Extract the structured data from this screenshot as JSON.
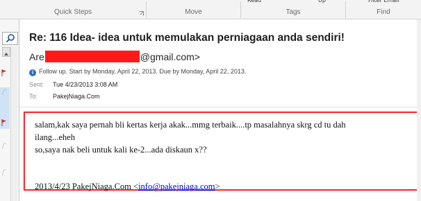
{
  "ribbon": {
    "top_labels": [
      "Read",
      "Up",
      "Filter Email"
    ],
    "groups": [
      "Quick Steps",
      "Move",
      "Tags",
      "Find"
    ]
  },
  "left": {
    "search_icon": "search-icon"
  },
  "message": {
    "subject": "Re: 116 Idea- idea untuk memulakan perniagaan anda sendiri!",
    "from_prefix": "Are",
    "from_suffix": "@gmail.com>",
    "followup": "Follow up.  Start by Monday, April 22, 2013.  Due by Monday, April 22, 2013.",
    "sent_label": "Sent:",
    "sent_value": "Tue 4/23/2013 3:08 AM",
    "to_label": "To:",
    "to_value": "PakejNiaga.Com"
  },
  "body": {
    "line1": "salam,kak saya pernah bli kertas kerja akak...mmg terbaik....tp masalahnya skrg cd tu dah",
    "line2": "ilang...eheh",
    "line3": "so,saya nak beli untuk kali ke-2...ada diskaun x??",
    "quote_prefix": "2013/4/23 PakejNiaga.Com <",
    "quote_link": "info@pakejniaga.com",
    "quote_suffix": ">"
  },
  "colors": {
    "highlight_box": "#ff2a2a",
    "link": "#0000ee",
    "info_icon": "#2a6fc4"
  }
}
